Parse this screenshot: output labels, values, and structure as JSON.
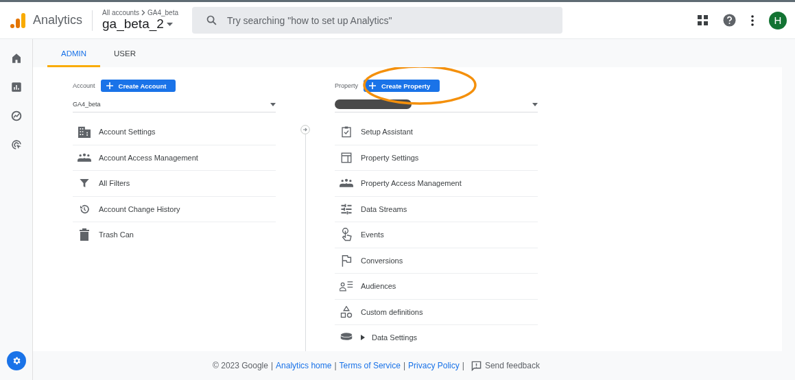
{
  "app": {
    "name": "Analytics"
  },
  "breadcrumb": {
    "path": [
      "All accounts",
      "GA4_beta"
    ],
    "property": "ga_beta_2"
  },
  "search": {
    "placeholder": "Try searching \"how to set up Analytics\""
  },
  "avatar": {
    "initial": "H"
  },
  "rail": [
    {
      "selected": false
    },
    {
      "selected": false
    },
    {
      "selected": false
    },
    {
      "selected": false
    },
    {
      "selected": true
    }
  ],
  "tabs": [
    {
      "label": "ADMIN",
      "selected": true
    },
    {
      "label": "USER",
      "selected": false
    }
  ],
  "account_column": {
    "label": "Account",
    "button": "Create Account",
    "selector": "GA4_beta",
    "items": [
      {
        "label": "Account Settings",
        "expandable": false
      },
      {
        "label": "Account Access Management",
        "expandable": false
      },
      {
        "label": "All Filters",
        "expandable": false
      },
      {
        "label": "Account Change History",
        "expandable": false
      },
      {
        "label": "Trash Can",
        "expandable": false
      }
    ]
  },
  "property_column": {
    "label": "Property",
    "button": "Create Property",
    "items": [
      {
        "label": "Setup Assistant",
        "expandable": false
      },
      {
        "label": "Property Settings",
        "expandable": false
      },
      {
        "label": "Property Access Management",
        "expandable": false
      },
      {
        "label": "Data Streams",
        "expandable": false
      },
      {
        "label": "Events",
        "expandable": false
      },
      {
        "label": "Conversions",
        "expandable": false
      },
      {
        "label": "Audiences",
        "expandable": false
      },
      {
        "label": "Custom definitions",
        "expandable": false
      },
      {
        "label": "Data Settings",
        "expandable": true
      }
    ]
  },
  "footer": [
    {
      "kind": "text",
      "text": "© 2023 Google"
    },
    {
      "kind": "separator",
      "text": "|"
    },
    {
      "kind": "link",
      "text": "Analytics home"
    },
    {
      "kind": "separator",
      "text": "|"
    },
    {
      "kind": "link",
      "text": "Terms of Service"
    },
    {
      "kind": "separator",
      "text": "|"
    },
    {
      "kind": "link",
      "text": "Privacy Policy"
    },
    {
      "kind": "separator",
      "text": "|"
    },
    {
      "kind": "feedback",
      "text": "Send feedback"
    }
  ]
}
